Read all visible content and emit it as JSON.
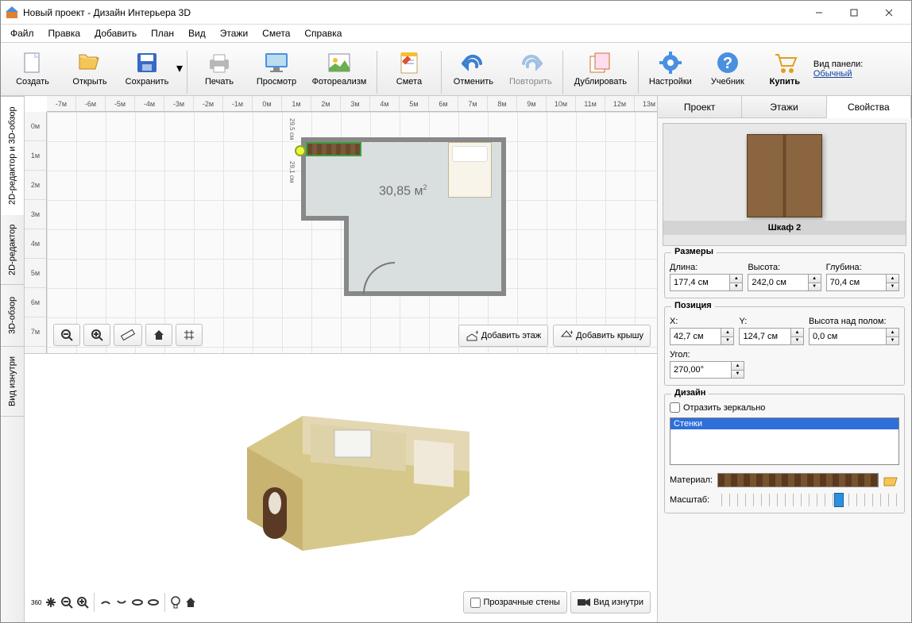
{
  "title": "Новый проект - Дизайн Интерьера 3D",
  "menu": [
    "Файл",
    "Правка",
    "Добавить",
    "План",
    "Вид",
    "Этажи",
    "Смета",
    "Справка"
  ],
  "panelLabel": "Вид панели:",
  "panelLink": "Обычный",
  "toolbar": [
    {
      "id": "create",
      "label": "Создать"
    },
    {
      "id": "open",
      "label": "Открыть"
    },
    {
      "id": "save",
      "label": "Сохранить"
    },
    {
      "id": "print",
      "label": "Печать"
    },
    {
      "id": "preview",
      "label": "Просмотр"
    },
    {
      "id": "photoreal",
      "label": "Фотореализм"
    },
    {
      "id": "estimate",
      "label": "Смета"
    },
    {
      "id": "undo",
      "label": "Отменить"
    },
    {
      "id": "redo",
      "label": "Повторить"
    },
    {
      "id": "duplicate",
      "label": "Дублировать"
    },
    {
      "id": "settings",
      "label": "Настройки"
    },
    {
      "id": "help",
      "label": "Учебник"
    },
    {
      "id": "buy",
      "label": "Купить"
    }
  ],
  "leftTabs": [
    "2D-редактор и 3D-обзор",
    "2D-редактор",
    "3D-обзор",
    "Вид изнутри"
  ],
  "rulerX": [
    "-7м",
    "-6м",
    "-5м",
    "-4м",
    "-3м",
    "-2м",
    "-1м",
    "0м",
    "1м",
    "2м",
    "3м",
    "4м",
    "5м",
    "6м",
    "7м",
    "8м",
    "9м",
    "10м",
    "11м",
    "12м",
    "13м"
  ],
  "rulerY": [
    "0м",
    "1м",
    "2м",
    "3м",
    "4м",
    "5м",
    "6м",
    "7м"
  ],
  "room": {
    "area": "30,85 м",
    "dim1": "29,5 см",
    "dim2": "29,1 см"
  },
  "btn2d": {
    "addFloor": "Добавить этаж",
    "addRoof": "Добавить крышу"
  },
  "btn3d": {
    "transp": "Прозрачные стены",
    "inside": "Вид изнутри"
  },
  "rightTabs": [
    "Проект",
    "Этажи",
    "Свойства"
  ],
  "object": {
    "name": "Шкаф 2"
  },
  "groups": {
    "size": "Размеры",
    "pos": "Позиция",
    "design": "Дизайн"
  },
  "size": {
    "len_l": "Длина:",
    "len": "177,4 см",
    "h_l": "Высота:",
    "h": "242,0 см",
    "d_l": "Глубина:",
    "d": "70,4 см"
  },
  "pos": {
    "x_l": "X:",
    "x": "42,7 см",
    "y_l": "Y:",
    "y": "124,7 см",
    "z_l": "Высота над полом:",
    "z": "0,0 см",
    "a_l": "Угол:",
    "a": "270,00°"
  },
  "design": {
    "mirror": "Отразить зеркально",
    "listSel": "Стенки",
    "mat_l": "Материал:",
    "scale_l": "Масштаб:"
  }
}
